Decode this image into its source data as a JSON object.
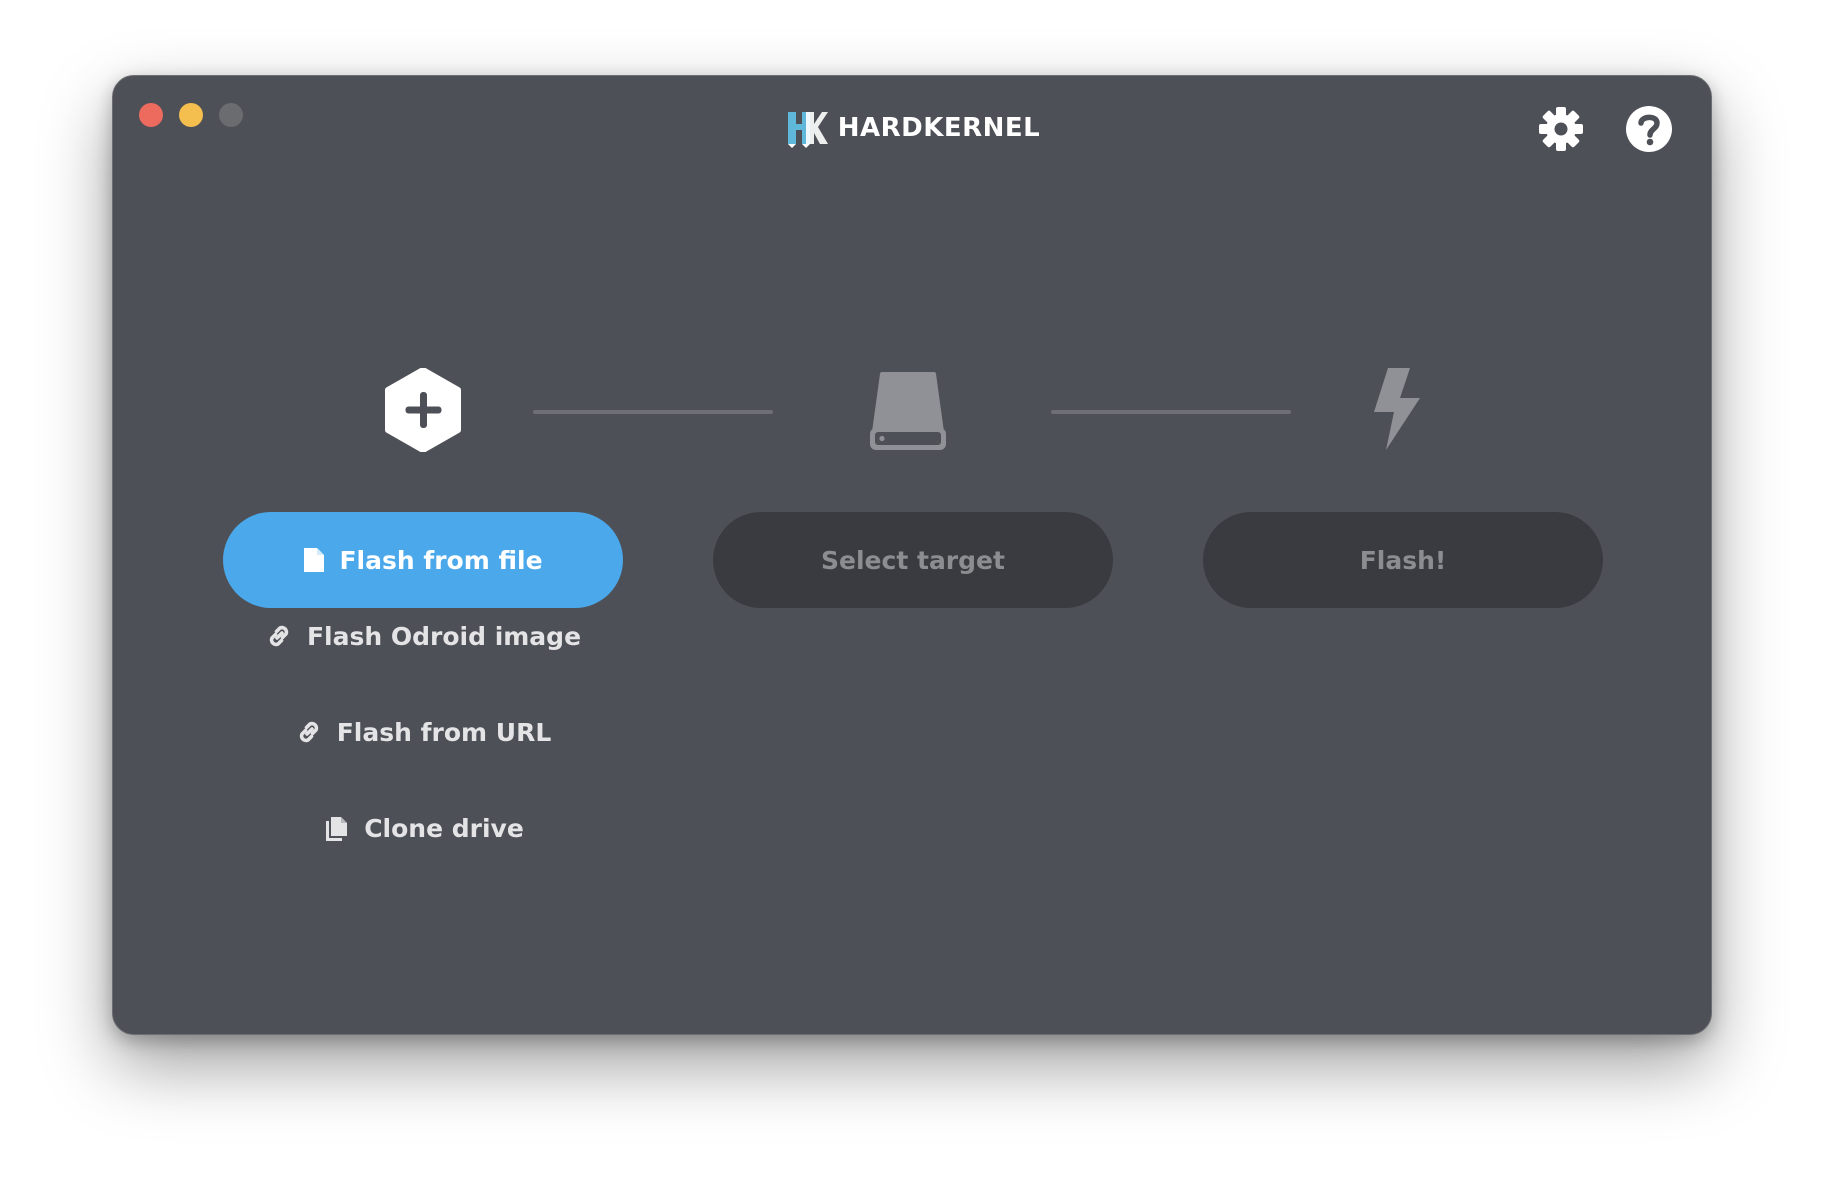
{
  "window": {
    "brand_name": "HARDKERNEL"
  },
  "steps": {
    "source": {
      "primary_label": "Flash from file",
      "options": [
        {
          "label": "Flash Odroid image",
          "icon": "link-icon"
        },
        {
          "label": "Flash from URL",
          "icon": "link-icon"
        },
        {
          "label": "Clone drive",
          "icon": "copy-icon"
        }
      ]
    },
    "target": {
      "label": "Select target"
    },
    "flash": {
      "label": "Flash!"
    }
  },
  "colors": {
    "window_bg": "#4e5057",
    "accent": "#4ba8ea",
    "disabled_bg": "#3a3b40",
    "disabled_text": "#8c8d91"
  }
}
